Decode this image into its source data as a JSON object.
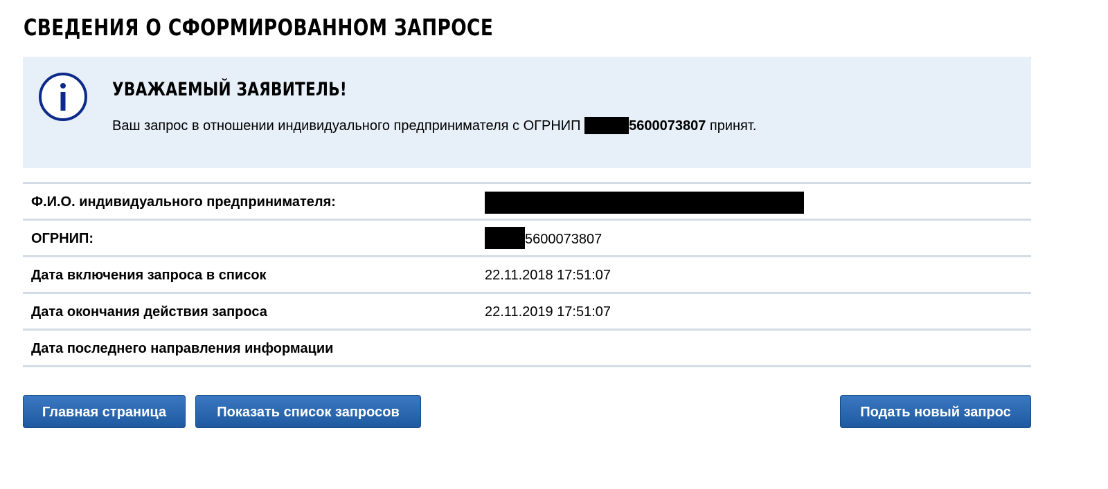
{
  "page": {
    "title": "СВЕДЕНИЯ О СФОРМИРОВАННОМ ЗАПРОСЕ"
  },
  "notice": {
    "icon": "info-icon",
    "heading": "УВАЖАЕМЫЙ ЗАЯВИТЕЛЬ!",
    "text_before": "Ваш запрос в отношении индивидуального предпринимателя с ОГРНИП ",
    "ogrnip_visible": "5600073807",
    "text_after": " принят."
  },
  "details": {
    "rows": [
      {
        "label": "Ф.И.О. индивидуального предпринимателя:",
        "value": ""
      },
      {
        "label": "ОГРНИП:",
        "value": "5600073807"
      },
      {
        "label": "Дата включения запроса в список",
        "value": "22.11.2018 17:51:07"
      },
      {
        "label": "Дата окончания действия запроса",
        "value": "22.11.2019 17:51:07"
      },
      {
        "label": "Дата последнего направления информации",
        "value": ""
      }
    ]
  },
  "buttons": {
    "home": "Главная страница",
    "list": "Показать список запросов",
    "new_request": "Подать новый запрос"
  },
  "colors": {
    "notice_bg": "#e7eff9",
    "divider": "#d3dce6",
    "button_top": "#3a78c2",
    "button_bottom": "#1f5aa0",
    "icon_blue": "#0d2a8a"
  }
}
